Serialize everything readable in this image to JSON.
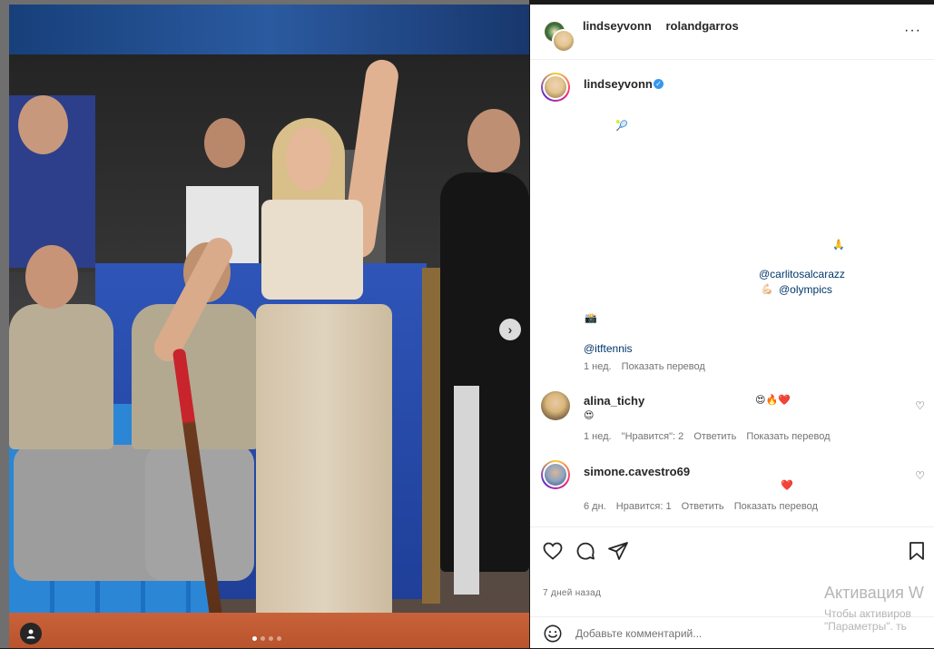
{
  "photo": {
    "next_arrow": "›",
    "carousel_dots": 4,
    "active_dot": 0,
    "tag_icon": "person-icon"
  },
  "header": {
    "user1": "lindseyvonn",
    "user2": "rolandgarros",
    "more_icon": "more-icon",
    "more_glyph": "···"
  },
  "caption": {
    "username": "lindseyvonn",
    "verified": "✓",
    "emoji_racket": "🎾",
    "emoji_pray": "🙏",
    "mention_alcaraz": "@carlitosalcarazz",
    "emoji_flex": "💪🏻",
    "mention_olympics": "@olympics",
    "emoji_camera": "📸",
    "mention_itf": "@itftennis",
    "time": "1 нед.",
    "translate": "Показать перевод"
  },
  "comments": [
    {
      "username": "alina_tichy",
      "emoji_line1": "😍🔥❤️",
      "emoji_line2": "😍",
      "time": "1 нед.",
      "likes": "\"Нравится\": 2",
      "reply": "Ответить",
      "translate": "Показать перевод"
    },
    {
      "username": "simone.cavestro69",
      "emoji_line1": "❤️",
      "time": "6 дн.",
      "likes": "Нравится: 1",
      "reply": "Ответить",
      "translate": "Показать перевод"
    }
  ],
  "actions": {
    "like_icon": "heart-icon",
    "comment_icon": "comment-icon",
    "share_icon": "share-icon",
    "save_icon": "bookmark-icon"
  },
  "time_ago": "7 дней назад",
  "comment_box": {
    "placeholder": "Добавьте комментарий...",
    "emoji_icon": "smile-icon"
  },
  "watermark": {
    "title": "Активация W",
    "subtitle": "Чтобы активиров",
    "subtitle2": "\"Параметры\".",
    "note": "ть"
  }
}
